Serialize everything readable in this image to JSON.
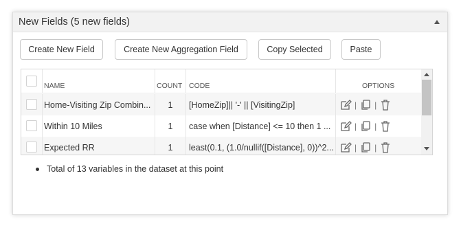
{
  "panel": {
    "title": "New Fields (5 new fields)",
    "collapse_icon": "chevron-up-icon"
  },
  "toolbar": {
    "create_new_field": "Create New Field",
    "create_new_aggregation_field": "Create New Aggregation Field",
    "copy_selected": "Copy Selected",
    "paste": "Paste"
  },
  "table": {
    "columns": {
      "name": "NAME",
      "count": "COUNT",
      "code": "CODE",
      "options": "OPTIONS"
    },
    "rows": [
      {
        "name": "Home-Visiting Zip Combin...",
        "count": "1",
        "code": "[HomeZip]|| '-' || [VisitingZip]"
      },
      {
        "name": "Within 10 Miles",
        "count": "1",
        "code": "case when [Distance] <= 10 then 1 ..."
      },
      {
        "name": "Expected RR",
        "count": "1",
        "code": "least(0.1, (1.0/nullif([Distance], 0))^2..."
      }
    ],
    "row_icons": [
      "edit-icon",
      "copy-icon",
      "trash-icon"
    ],
    "separator": "|"
  },
  "footer_note": "Total of 13 variables in the dataset at this point",
  "colors": {
    "header_bg": "#f2f2f2",
    "alt_row_bg": "#f6f6f6",
    "border": "#d6d6d6",
    "text": "#333333"
  }
}
